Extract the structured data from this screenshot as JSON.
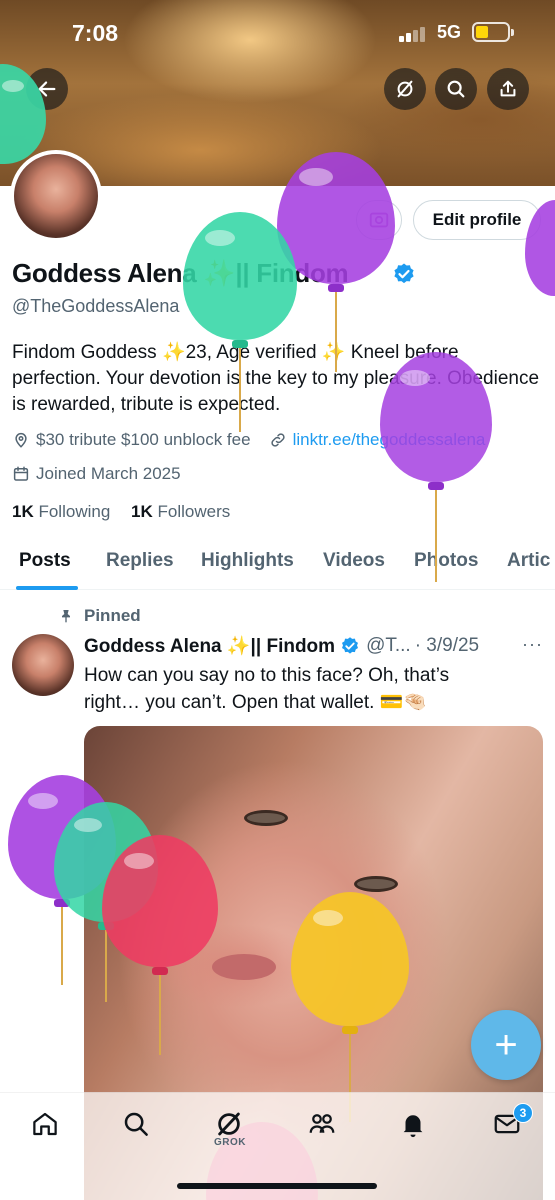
{
  "status_bar": {
    "time": "7:08",
    "network": "5G"
  },
  "colors": {
    "accent": "#1d9bf0",
    "text": "#0f1419",
    "secondary": "#536471"
  },
  "header": {
    "back_icon": "back-arrow-icon",
    "actions": [
      "grok-icon",
      "search-icon",
      "share-icon"
    ]
  },
  "profile": {
    "edit_profile_label": "Edit profile",
    "display_name": "Goddess Alena ✨|| Findom",
    "handle": "@TheGoddessAlena",
    "bio": "Findom Goddess ✨23, Age verified ✨ Kneel before perfection. Your devotion is the key to my pleasure. Obedience is rewarded, tribute is expected.",
    "location": "$30 tribute $100 unblock fee",
    "link": "linktr.ee/thegoddessalena",
    "joined": "Joined March 2025",
    "following_count": "1K",
    "following_label": "Following",
    "followers_count": "1K",
    "followers_label": "Followers"
  },
  "tabs": [
    "Posts",
    "Replies",
    "Highlights",
    "Videos",
    "Photos",
    "Artic"
  ],
  "active_tab": "Posts",
  "pinned_post": {
    "pinned_label": "Pinned",
    "author_name": "Goddess Alena ✨|| Findom",
    "author_handle": "@T...",
    "date": "· 3/9/25",
    "more": "···",
    "text_line1": "How can you say no to this face? Oh, that’s",
    "text_line2": "right… you can’t. Open that wallet. 💳🤏🏻"
  },
  "fab_label": "+",
  "bottom_nav": {
    "items": [
      "home-icon",
      "search-icon",
      "grok-icon",
      "communities-icon",
      "notifications-icon",
      "messages-icon"
    ],
    "grok_label": "GROK",
    "messages_badge": "3"
  }
}
